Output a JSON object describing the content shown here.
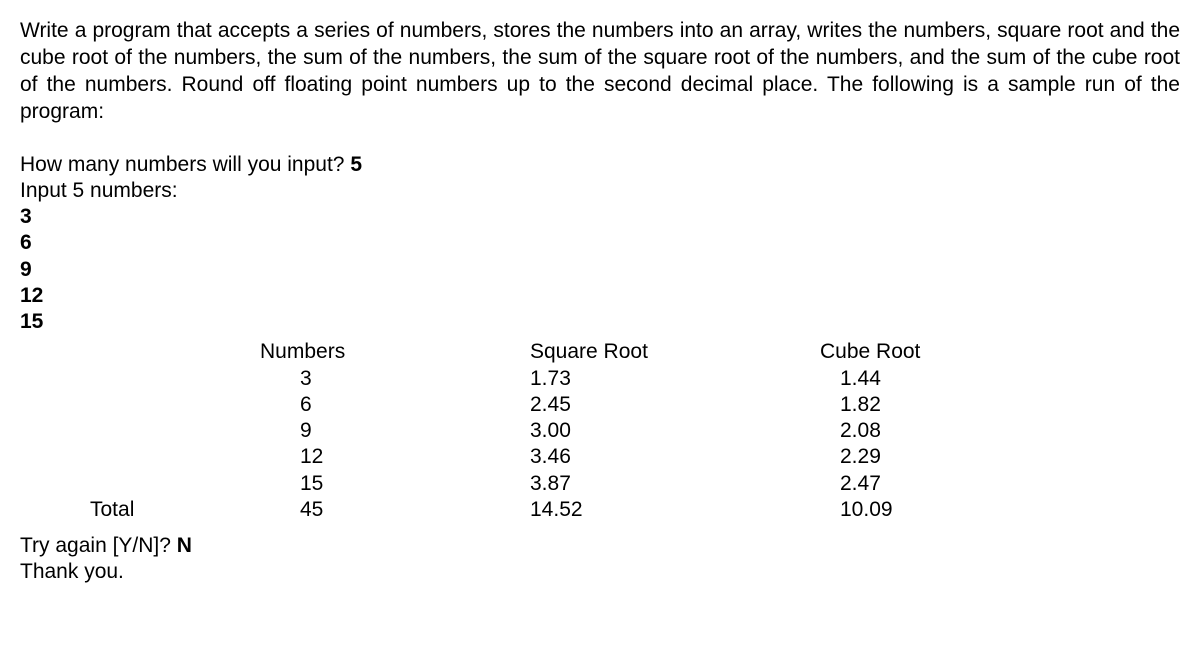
{
  "instructions": "Write a program that accepts a series of numbers, stores the numbers into an array, writes the numbers, square root and the cube root of the numbers, the sum of the numbers, the sum of the square root of the numbers, and the sum of the cube root of the numbers.  Round off floating point numbers up to the second decimal place.  The following is a sample run of the program:",
  "prompt_count_q": "How many numbers will you input? ",
  "prompt_count_a": "5",
  "prompt_input": "Input 5 numbers:",
  "inputs": [
    "3",
    "6",
    "9",
    "12",
    "15"
  ],
  "headers": {
    "num": "Numbers",
    "sqrt": "Square Root",
    "cbrt": "Cube Root"
  },
  "rows": [
    {
      "num": "3",
      "sqrt": "1.73",
      "cbrt": "1.44"
    },
    {
      "num": "6",
      "sqrt": "2.45",
      "cbrt": "1.82"
    },
    {
      "num": "9",
      "sqrt": "3.00",
      "cbrt": "2.08"
    },
    {
      "num": "12",
      "sqrt": "3.46",
      "cbrt": "2.29"
    },
    {
      "num": "15",
      "sqrt": "3.87",
      "cbrt": "2.47"
    }
  ],
  "total_label": "Total",
  "totals": {
    "num": "45",
    "sqrt": "14.52",
    "cbrt": "10.09"
  },
  "try_again_q": "Try again [Y/N]? ",
  "try_again_a": "N",
  "thank_you": "Thank you.",
  "chart_data": {
    "type": "table",
    "title": "Numbers, Square Root, Cube Root",
    "columns": [
      "Numbers",
      "Square Root",
      "Cube Root"
    ],
    "rows": [
      [
        3,
        1.73,
        1.44
      ],
      [
        6,
        2.45,
        1.82
      ],
      [
        9,
        3.0,
        2.08
      ],
      [
        12,
        3.46,
        2.29
      ],
      [
        15,
        3.87,
        2.47
      ]
    ],
    "totals": [
      45,
      14.52,
      10.09
    ]
  }
}
